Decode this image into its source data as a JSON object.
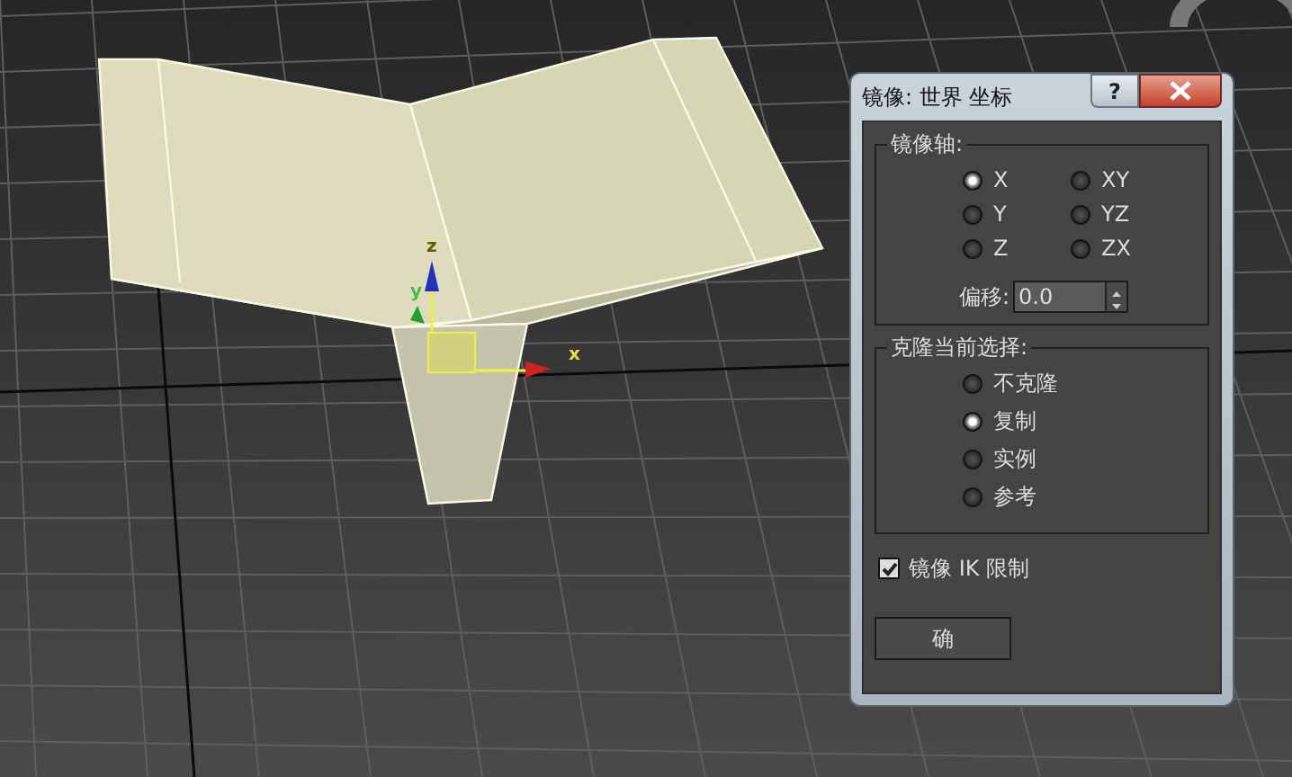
{
  "viewport": {
    "gizmo_labels": [
      "z",
      "y",
      "x"
    ]
  },
  "dialog": {
    "title": "镜像: 世界 坐标",
    "help_button": "?",
    "mirror_axis": {
      "label": "镜像轴:",
      "options": [
        {
          "label": "X",
          "selected": true
        },
        {
          "label": "XY",
          "selected": false
        },
        {
          "label": "Y",
          "selected": false
        },
        {
          "label": "YZ",
          "selected": false
        },
        {
          "label": "Z",
          "selected": false
        },
        {
          "label": "ZX",
          "selected": false
        }
      ],
      "offset": {
        "label": "偏移:",
        "value": "0.0"
      }
    },
    "clone_selection": {
      "label": "克隆当前选择:",
      "options": [
        {
          "label": "不克隆",
          "selected": false
        },
        {
          "label": "复制",
          "selected": true
        },
        {
          "label": "实例",
          "selected": false
        },
        {
          "label": "参考",
          "selected": false
        }
      ]
    },
    "mirror_ik": {
      "label": "镜像 IK 限制",
      "checked": true
    },
    "buttons": [
      "确"
    ]
  }
}
